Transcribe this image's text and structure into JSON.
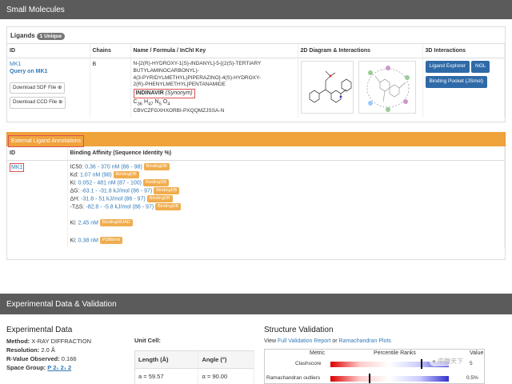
{
  "small_molecules": {
    "title": "Small Molecules"
  },
  "ligands": {
    "label": "Ligands",
    "badge": "1 Unique",
    "columns": [
      "ID",
      "Chains",
      "Name / Formula / InChI Key",
      "2D Diagram & Interactions",
      "3D Interactions"
    ],
    "id": "MK1",
    "query": "Query on MK1",
    "chains": "B",
    "name_lines": [
      "N-[2(R)-HYDROXY-1(S)-INDANYL]-5-[(2(S)-TERTIARY",
      "BUTYLAMINOCARBONYL)-",
      "4(3-PYRIDYLMETHYL)PIPERAZINO]-4(S)-HYDROXY-",
      "2(R)-PHENYLMETHYL]PENTANAMIDE"
    ],
    "synonym_name": "INDINAVIR",
    "synonym_tag": "(Synonym)",
    "formula": {
      "c": "C",
      "c_n": "36",
      "h": "H",
      "h_n": "47",
      "n": "N",
      "n_n": "5",
      "o": "O",
      "o_n": "4"
    },
    "inchi": "CBVCZFGXHXORBI-PXQQMZJSSA-N",
    "download_sdf": "Download SDF File ⊕",
    "download_ccd": "Download CCD File ⊕",
    "btn_explorer": "Ligand Explorer",
    "btn_ngl": "NGL",
    "btn_pocket": "Binding Pocket (JSmol)"
  },
  "external": {
    "title": "External Ligand Annotations",
    "columns": [
      "ID",
      "Binding Affinity (Sequence Identity %)"
    ],
    "id": "MK1",
    "rows": [
      {
        "k": "IC50:",
        "v": "0.36 - 370 nM (86 - 98)",
        "tag": "BindingDB"
      },
      {
        "k": "Kd:",
        "v": "1.07 nM (98)",
        "tag": "BindingDB"
      },
      {
        "k": "Ki:",
        "v": "0.052 - 481 nM (87 - 100)",
        "tag": "BindingDB"
      },
      {
        "k": "ΔG:",
        "v": "-63.1 - -31.8 kJ/mol (86 - 97)",
        "tag": "BindingDB"
      },
      {
        "k": "ΔH:",
        "v": "-31.8 - 51 kJ/mol (86 - 97)",
        "tag": "BindingDB"
      },
      {
        "k": "-TΔS:",
        "v": "-82.8 - -5.8 kJ/mol (86 - 97)",
        "tag": "BindingDB"
      }
    ],
    "moad": {
      "k": "Ki:",
      "v": "2.45 nM",
      "tag": "BindingMOAD"
    },
    "pdbbind": {
      "k": "Ki:",
      "v": "0.38 nM",
      "tag": "PDBbind"
    }
  },
  "experimental": {
    "bar_title": "Experimental Data & Validation",
    "title": "Experimental Data",
    "method_k": "Method:",
    "method_v": "X-RAY DIFFRACTION",
    "res_k": "Resolution:",
    "res_v": "2.0 Å",
    "rval_k": "R-Value Observed:",
    "rval_v": "0.166",
    "sg_k": "Space Group:",
    "sg_v": "P 2₁ 2₁ 2",
    "unit_cell": "Unit Cell:",
    "uc_cols": [
      "Length (Å)",
      "Angle (°)"
    ],
    "uc_row": [
      "a = 59.57",
      "α = 90.00"
    ]
  },
  "validation": {
    "title": "Structure Validation",
    "view": "View",
    "full": "Full Validation Report",
    "or": "or",
    "rama": "Ramachandran Plots",
    "col_metric": "Metric",
    "col_pct": "Percentile Ranks",
    "col_val": "Value",
    "rows": [
      {
        "name": "Clashscore",
        "value": "5"
      },
      {
        "name": "Ramachandran outliers",
        "value": "0.5%"
      }
    ],
    "watermark": "中微天下"
  }
}
